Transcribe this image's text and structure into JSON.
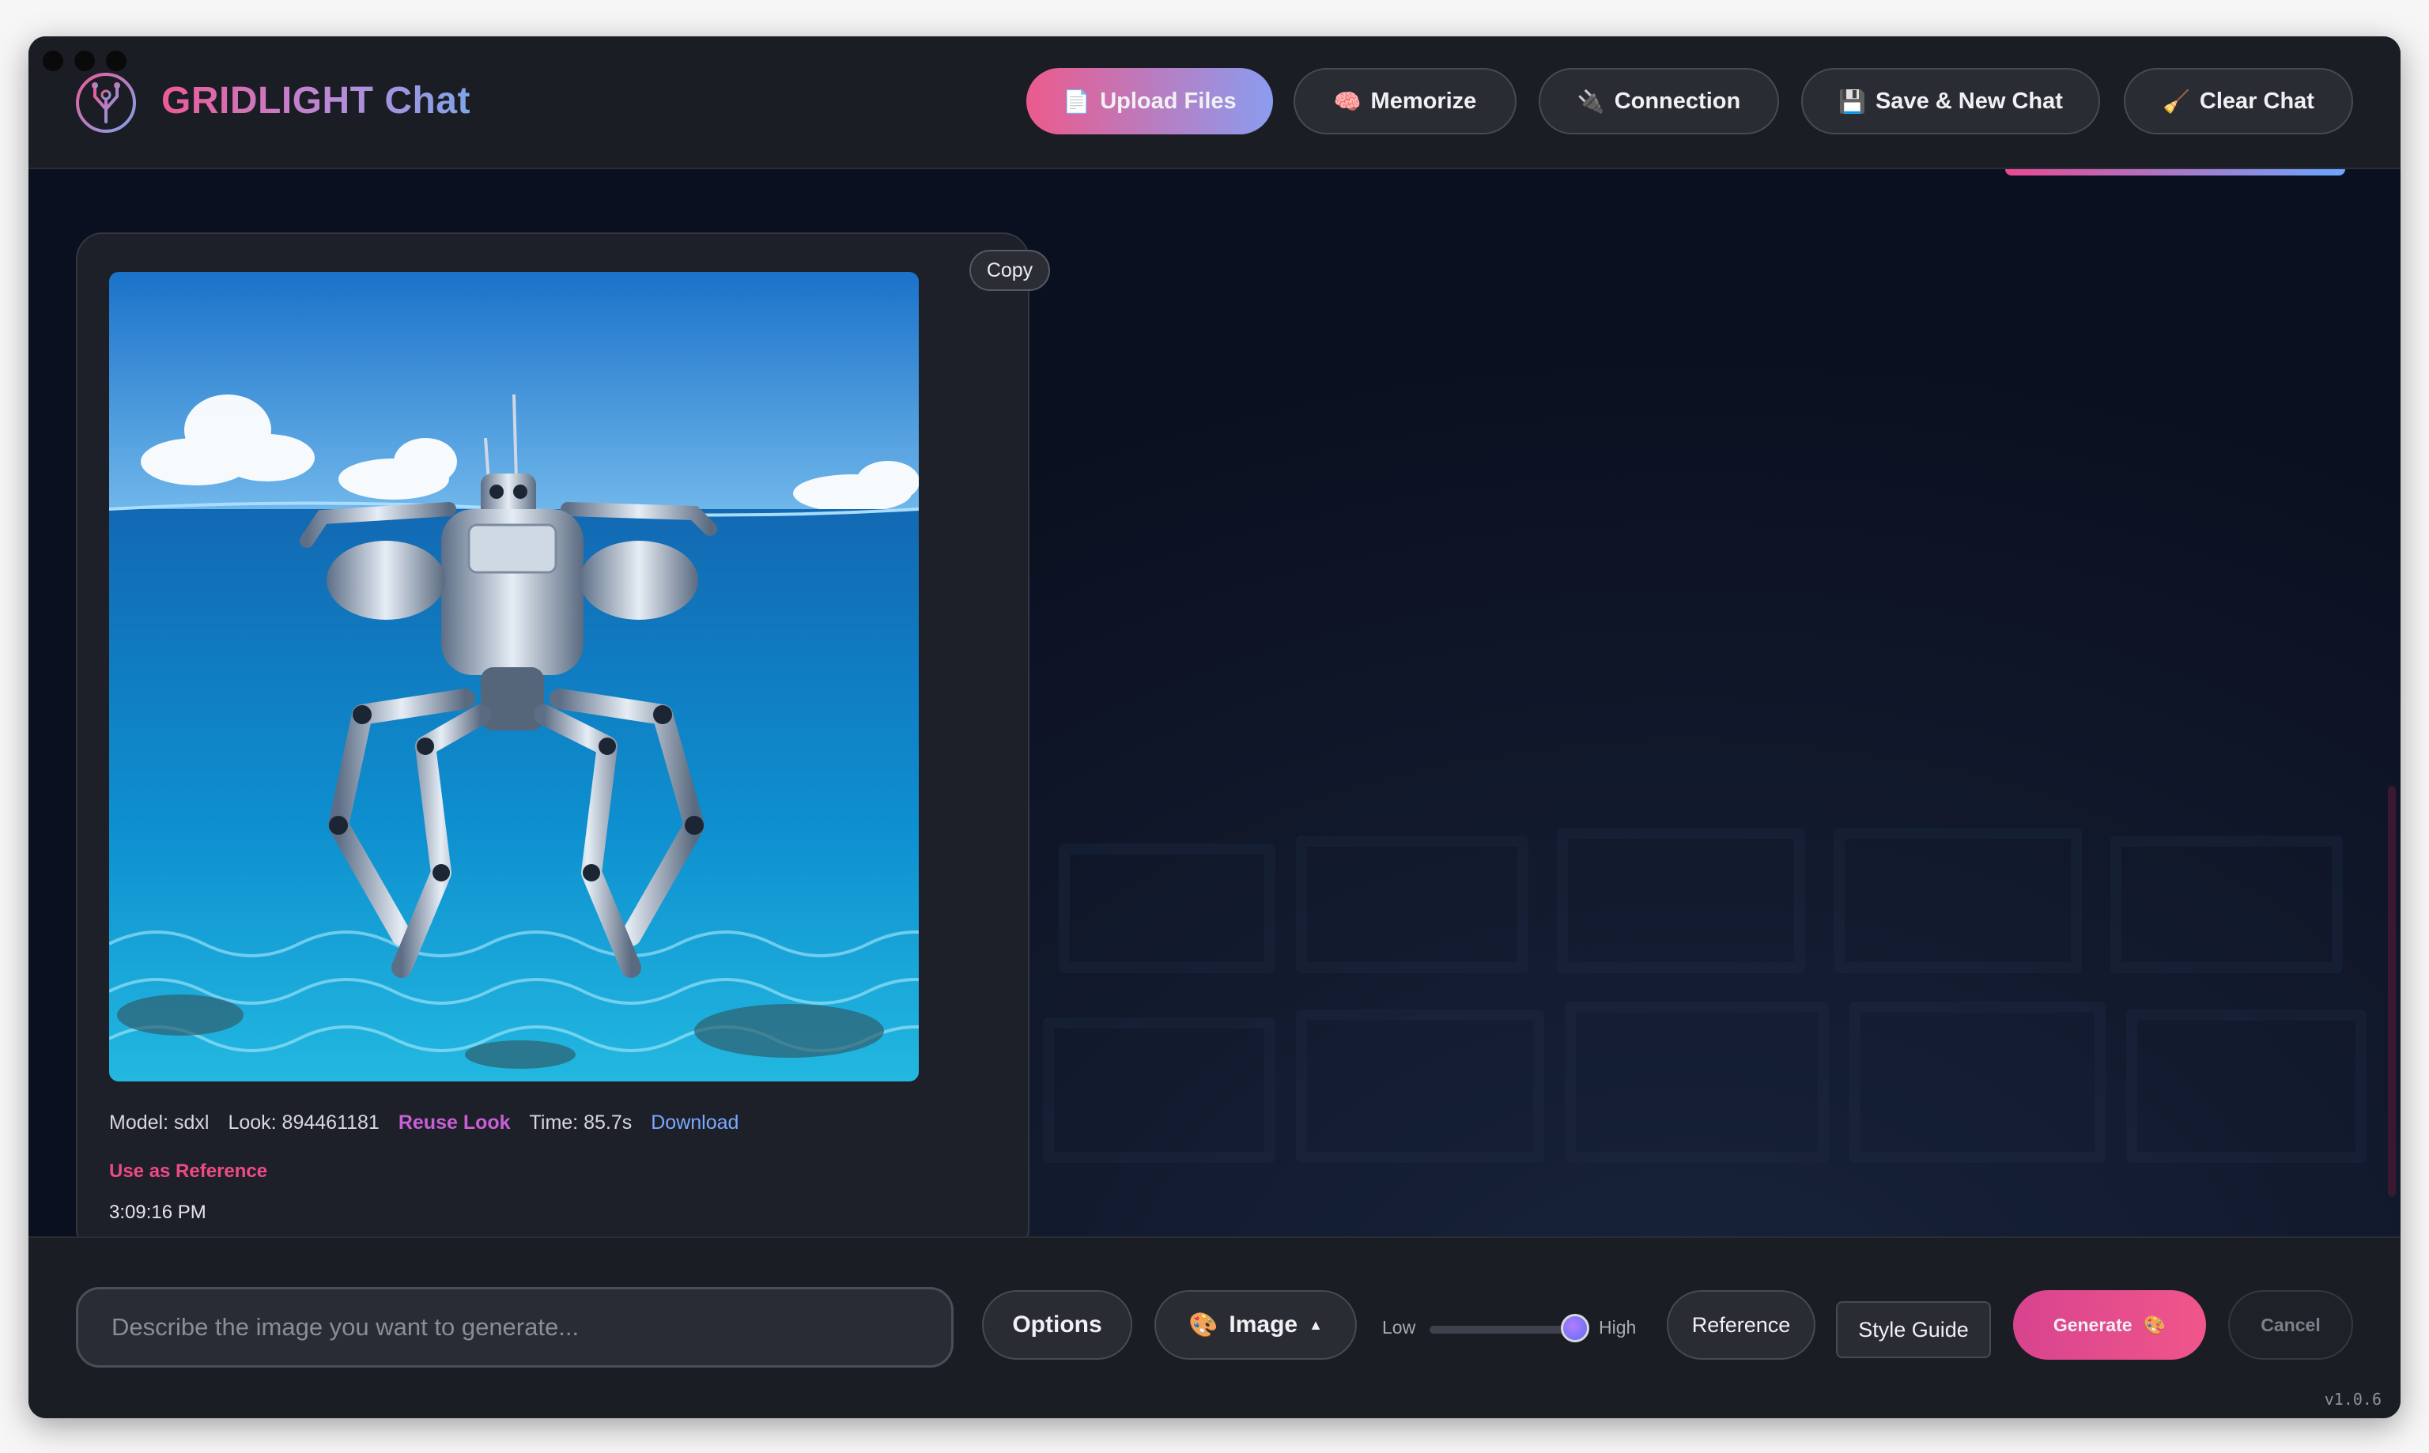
{
  "app": {
    "brand": "GRIDLIGHT Chat",
    "version": "v1.0.6"
  },
  "header": {
    "buttons": [
      {
        "label": "Upload Files",
        "icon": "file-icon"
      },
      {
        "label": "Memorize",
        "icon": "brain-icon"
      },
      {
        "label": "Connection",
        "icon": "plug-icon"
      },
      {
        "label": "Save & New Chat",
        "icon": "floppy-disk-icon"
      },
      {
        "label": "Clear Chat",
        "icon": "broom-icon"
      }
    ]
  },
  "message": {
    "copy_label": "Copy",
    "image_alt": "Robot swimming underwater",
    "model": "Model: sdxl",
    "look": "Look: 894461181",
    "reuse_look": "Reuse Look",
    "time": "Time: 85.7s",
    "download": "Download",
    "use_as_reference": "Use as Reference",
    "timestamp": "3:09:16 PM"
  },
  "composer": {
    "placeholder": "Describe the image you want to generate...",
    "options": "Options",
    "mode": "Image",
    "mode_caret": "▲",
    "slider_low": "Low",
    "slider_high": "High",
    "slider_value": 1.0,
    "reference": "Reference",
    "style_guide": "Style Guide",
    "generate": "Generate",
    "cancel": "Cancel"
  },
  "colors": {
    "accent_pink": "#ec5a8c",
    "accent_blue": "#8a9cf0",
    "background": "#0b1020"
  }
}
